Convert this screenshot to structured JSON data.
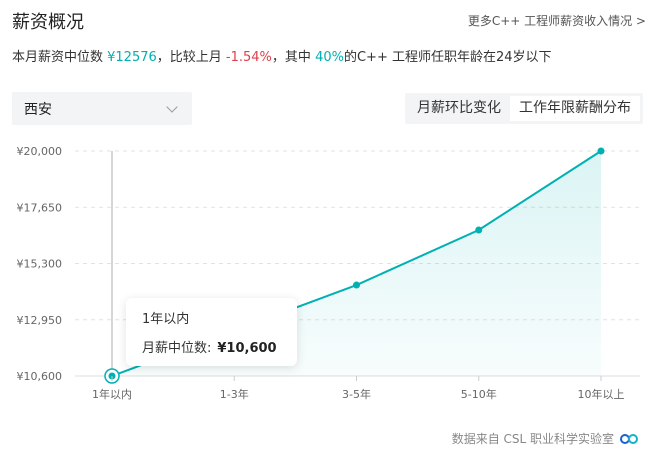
{
  "header": {
    "title": "薪资概况",
    "more_link": "更多C++ 工程师薪资收入情况 >"
  },
  "summary": {
    "prefix": "本月薪资中位数 ",
    "median": "¥12576",
    "mid1": "，比较上月 ",
    "change": "-1.54%",
    "mid2": "，其中 ",
    "pct": "40%",
    "suffix": "的C++ 工程师任职年龄在24岁以下"
  },
  "filter": {
    "city": "西安"
  },
  "tabs": [
    {
      "label": "月薪环比变化",
      "active": false
    },
    {
      "label": "工作年限薪酬分布",
      "active": true
    }
  ],
  "tooltip": {
    "title": "1年以内",
    "label": "月薪中位数:",
    "value": "¥10,600"
  },
  "footer": {
    "source": "数据来自 CSL 职业科学实验室"
  },
  "colors": {
    "accent": "#00b0b2",
    "negative": "#e0404a"
  },
  "chart_data": {
    "type": "area",
    "categories": [
      "1年以内",
      "1-3年",
      "3-5年",
      "5-10年",
      "10年以上"
    ],
    "values": [
      10600,
      null,
      14400,
      16700,
      20000
    ],
    "ylim": [
      10600,
      20000
    ],
    "yticks": [
      10600,
      12950,
      15300,
      17650,
      20000
    ],
    "ytick_labels": [
      "¥10,600",
      "¥12,950",
      "¥15,300",
      "¥17,650",
      "¥20,000"
    ],
    "grid": true,
    "highlighted_index": 0
  }
}
